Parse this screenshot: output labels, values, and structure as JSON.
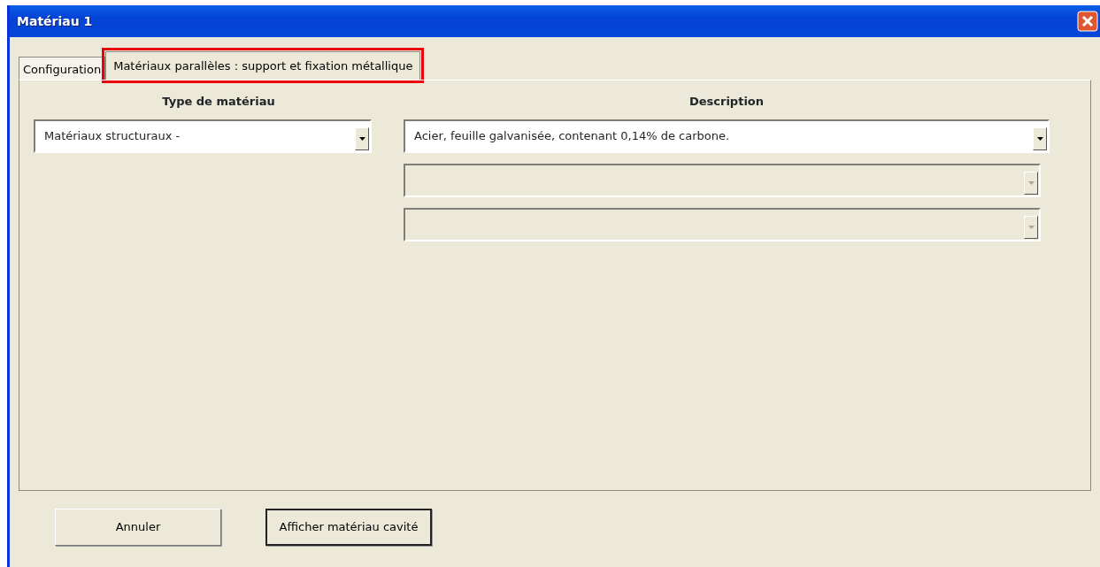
{
  "window": {
    "title": "Matériau  1"
  },
  "tabs": [
    {
      "label": "Configuration",
      "selected": false,
      "highlighted": false
    },
    {
      "label": "Matériaux parallèles : support et fixation métallique",
      "selected": true,
      "highlighted": true
    }
  ],
  "columns": [
    {
      "heading": "Type de matériau"
    },
    {
      "heading": "Description"
    }
  ],
  "type_combo": {
    "value": "Matériaux structuraux -",
    "disabled": false
  },
  "description_combos": [
    {
      "value": "Acier, feuille galvanisée, contenant 0,14% de carbone.",
      "disabled": false
    },
    {
      "disabled": true
    },
    {
      "disabled": true
    }
  ],
  "buttons": [
    {
      "label": "Annuler",
      "default": false
    },
    {
      "label": "Afficher matériau cavité",
      "default": true
    }
  ]
}
